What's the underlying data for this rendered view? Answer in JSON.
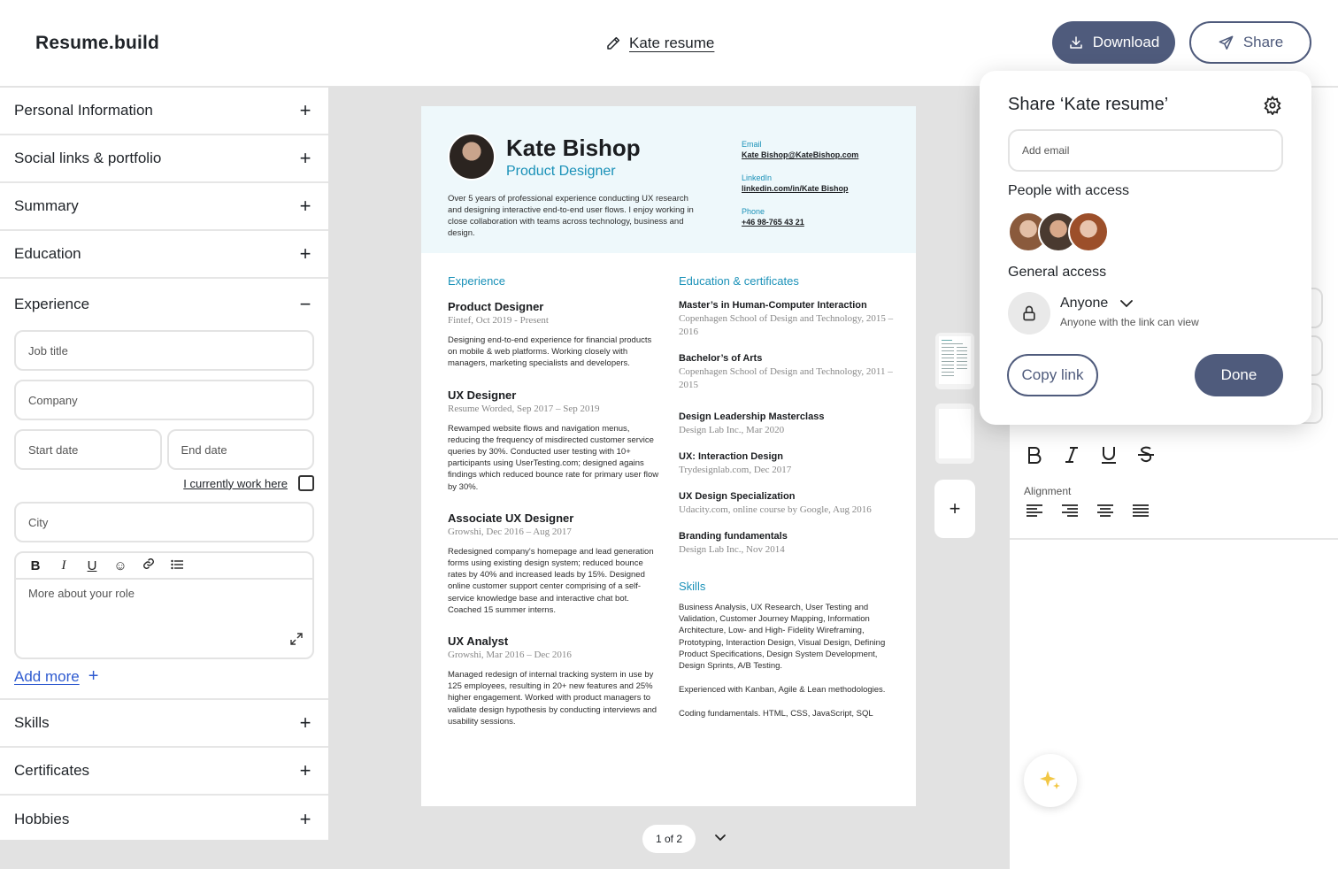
{
  "app": {
    "logo": "Resume.build"
  },
  "header": {
    "doc_title": "Kate resume",
    "download_label": "Download",
    "share_label": "Share"
  },
  "sidebar": {
    "sections_top": [
      {
        "label": "Personal Information",
        "toggle": "+"
      },
      {
        "label": "Social links & portfolio",
        "toggle": "+"
      },
      {
        "label": "Summary",
        "toggle": "+"
      },
      {
        "label": "Education",
        "toggle": "+"
      }
    ],
    "experience": {
      "label": "Experience",
      "toggle": "−",
      "job_title_placeholder": "Job title",
      "company_placeholder": "Company",
      "start_date_placeholder": "Start date",
      "end_date_placeholder": "End date",
      "current_work_label": "I currently work here",
      "city_placeholder": "City",
      "role_placeholder": "More about your role",
      "add_more_label": "Add more"
    },
    "sections_bottom": [
      {
        "label": "Skills",
        "toggle": "+"
      },
      {
        "label": "Certificates",
        "toggle": "+"
      },
      {
        "label": "Hobbies",
        "toggle": "+"
      }
    ]
  },
  "resume": {
    "name": "Kate Bishop",
    "role": "Product Designer",
    "summary": "Over 5 years of professional experience conducting UX research and designing interactive end-to-end user flows. I enjoy working in close collaboration with teams across technology, business and design.",
    "contacts": [
      {
        "label": "Email",
        "value": "Kate Bishop@KateBishop.com"
      },
      {
        "label": "LinkedIn",
        "value": "linkedin.com/in/Kate Bishop"
      },
      {
        "label": "Phone",
        "value": "+46 98-765 43 21"
      }
    ],
    "experience_heading": "Experience",
    "jobs": [
      {
        "title": "Product Designer",
        "meta": "Fintef, Oct 2019 - Present",
        "desc": "Designing end-to-end experience for financial products on mobile & web platforms. Working closely with managers, marketing specialists and developers."
      },
      {
        "title": "UX Designer",
        "meta": "Resume Worded, Sep 2017 – Sep 2019",
        "desc": "Rewamped website flows and navigation menus, reducing the frequency of misdirected customer service queries by 30%. Conducted user testing with 10+ participants using UserTesting.com; designed agains findings which reduced bounce rate for primary user flow by 30%."
      },
      {
        "title": "Associate UX Designer",
        "meta": "Growshi, Dec 2016 – Aug 2017",
        "desc": "Redesigned company's homepage and lead generation forms using existing design system; reduced bounce rates by 40% and increased leads by 15%. Designed online customer support center comprising of a self-service knowledge base and interactive chat bot. Coached 15 summer interns."
      },
      {
        "title": "UX Analyst",
        "meta": "Growshi, Mar 2016 – Dec 2016",
        "desc": "Managed redesign of internal tracking system in use by 125 employees, resulting in 20+ new features and 25% higher engagement. Worked with product managers to validate design hypothesis by conducting interviews and usability sessions."
      }
    ],
    "education_heading": "Education & certificates",
    "education": [
      {
        "title": "Master’s in Human-Computer Interaction",
        "meta": "Copenhagen School of Design and Technology, 2015 – 2016"
      },
      {
        "title": "Bachelor’s of Arts",
        "meta": "Copenhagen School of Design and Technology, 2011 – 2015"
      },
      {
        "title": "Design Leadership Masterclass",
        "meta": "Design Lab Inc., Mar 2020"
      },
      {
        "title": "UX: Interaction Design",
        "meta": "Trydesignlab.com, Dec 2017"
      },
      {
        "title": "UX Design Specialization",
        "meta": "Udacity.com, online course by Google, Aug 2016"
      },
      {
        "title": "Branding fundamentals",
        "meta": "Design Lab Inc., Nov 2014"
      }
    ],
    "skills_heading": "Skills",
    "skills": [
      "Business Analysis, UX Research, User Testing and Validation, Customer Journey Mapping, Information Architecture, Low- and High- Fidelity Wireframing, Prototyping, Interaction Design, Visual Design, Defining Product Specifications, Design System Development, Design Sprints, A/B Testing.",
      "Experienced with Kanban, Agile & Lean methodologies.",
      "Coding fundamentals. HTML, CSS, JavaScript, SQL"
    ]
  },
  "pager": {
    "label": "1 of 2"
  },
  "right_panel": {
    "alignment_label": "Alignment"
  },
  "share_dialog": {
    "title": "Share ‘Kate resume’",
    "email_placeholder": "Add email",
    "people_label": "People with access",
    "general_access_label": "General access",
    "access_level": "Anyone",
    "access_desc": "Anyone with the link can view",
    "copy_link_label": "Copy link",
    "done_label": "Done"
  },
  "colors": {
    "primary": "#4f5b7c",
    "accent_blue": "#1a91b8",
    "link_blue": "#2f5bd0"
  }
}
